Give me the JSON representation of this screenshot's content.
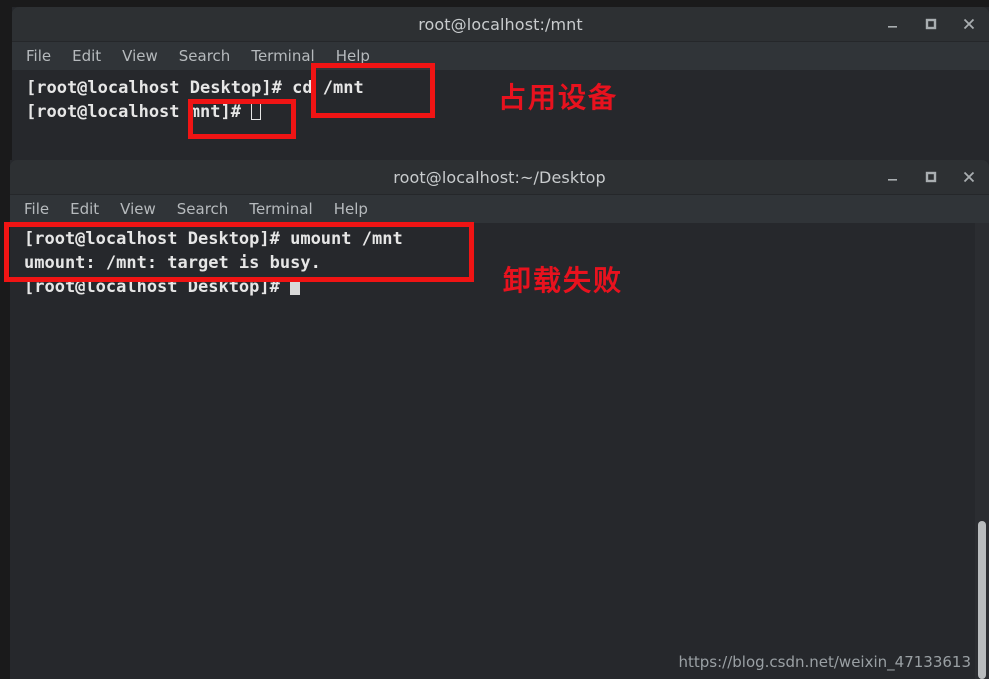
{
  "desktop": {
    "background": "#1a1a1b",
    "watermark": "https://blog.csdn.net/weixin_47133613"
  },
  "colors": {
    "titlebar": "#2d3033",
    "menubar": "#303438",
    "terminal_bg": "#26282c",
    "terminal_fg": "#e6e6e6",
    "annotation_red": "#e8121e",
    "box_red": "#f01414"
  },
  "window1": {
    "title": "root@localhost:/mnt",
    "menu": [
      "File",
      "Edit",
      "View",
      "Search",
      "Terminal",
      "Help"
    ],
    "controls": {
      "minimize": "minimize-icon",
      "maximize": "maximize-icon",
      "close": "close-icon"
    },
    "lines": [
      "[root@localhost Desktop]# cd /mnt",
      "[root@localhost mnt]# "
    ]
  },
  "window2": {
    "title": "root@localhost:~/Desktop",
    "menu": [
      "File",
      "Edit",
      "View",
      "Search",
      "Terminal",
      "Help"
    ],
    "controls": {
      "minimize": "minimize-icon",
      "maximize": "maximize-icon",
      "close": "close-icon"
    },
    "lines": [
      "[root@localhost Desktop]# umount /mnt",
      "umount: /mnt: target is busy.",
      "[root@localhost Desktop]# "
    ]
  },
  "annotations": {
    "occupying_device": "占用设备",
    "unmount_failed": "卸载失败"
  }
}
